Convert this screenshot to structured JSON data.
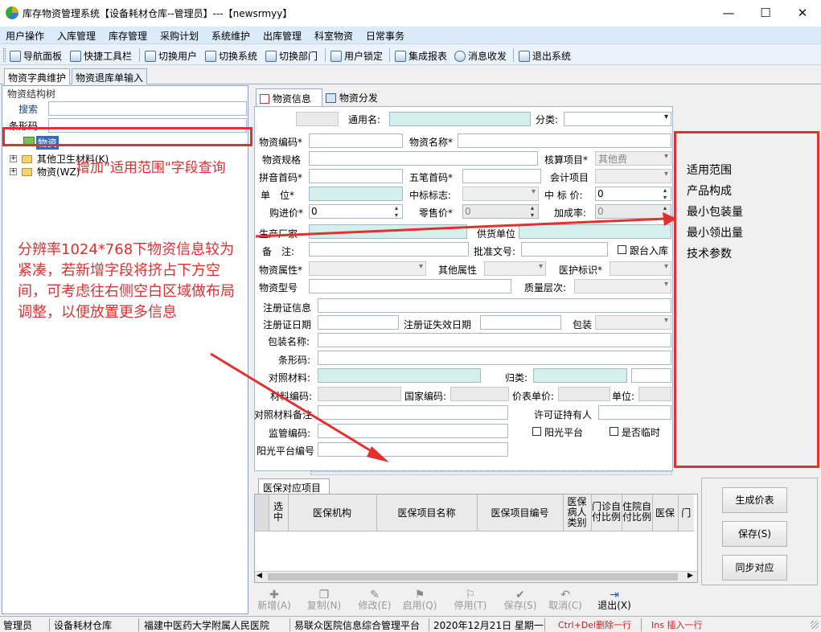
{
  "window": {
    "title": "库存物资管理系统【设备耗材仓库--管理员】---【newsrmyy】",
    "min": "—",
    "max": "☐",
    "close": "✕"
  },
  "menu": [
    "用户操作",
    "入库管理",
    "库存管理",
    "采购计划",
    "系统维护",
    "出库管理",
    "科室物资",
    "日常事务"
  ],
  "toolbar": [
    "导航面板",
    "快捷工具栏",
    "切换用户",
    "切换系统",
    "切换部门",
    "用户锁定",
    "集成报表",
    "消息收发",
    "退出系统"
  ],
  "tabs": [
    "物资字典维护",
    "物资退库单输入"
  ],
  "left": {
    "group": "物资结构树",
    "search": "搜索",
    "barcode": "条形码",
    "tree": [
      "物资",
      "其他卫生材料(K)",
      "物资(WZ)"
    ]
  },
  "subtabs": [
    "物资信息",
    "物资分发"
  ],
  "form": {
    "common_name": "通用名:",
    "category": "分类:",
    "code": "物资编码*",
    "name": "物资名称*",
    "spec": "物资规格",
    "acct_item": "核算项目*",
    "acct_item_val": "其他费",
    "pinyin": "拼音首码*",
    "wubi": "五笔首码*",
    "ledger_item": "会计项目",
    "unit": "单　位*",
    "bid_flag": "中标标志:",
    "bid_price": "中 标 价:",
    "bid_price_val": "0",
    "purchase_price": "购进价*",
    "purchase_price_val": "0",
    "retail_price": "零售价*",
    "retail_price_val": "0",
    "markup": "加成率:",
    "markup_val": "0",
    "maker": "生产厂家",
    "supplier": "供货单位",
    "remark": "备　注:",
    "approval": "批准文号:",
    "follow_in": "跟台入库",
    "attr": "物资属性*",
    "other_attr": "其他属性",
    "care_flag": "医护标识*",
    "model": "物资型号",
    "quality": "质量层次:",
    "reg_info": "注册证信息",
    "reg_date": "注册证日期",
    "reg_expire": "注册证失效日期",
    "package": "包装",
    "package_name": "包装名称:",
    "barcode": "条形码:",
    "compare_material": "对照材料:",
    "classify": "归类:",
    "material_code": "材料编码:",
    "national_code": "国家编码:",
    "price_unit_price": "价表单价:",
    "unit2": "单位:",
    "compare_remark": "对照材料备注",
    "license_holder": "许可证持有人",
    "supervise_code": "监管编码:",
    "sunshine": "阳光平台",
    "temporary": "是否临时",
    "sunshine_code": "阳光平台编号"
  },
  "annotations": {
    "a1": "增加\"适用范围\"字段查询",
    "a2": "分辨率1024*768下物资信息较为紧凑，若新增字段将挤占下方空间，可考虑往右侧空白区域做布局调整，以便放置更多信息",
    "new_fields": [
      "适用范围",
      "产品构成",
      "最小包装量",
      "最小领出量",
      "技术参数"
    ]
  },
  "medins": {
    "tab": "医保对应项目",
    "cols": [
      "选中",
      "医保机构",
      "医保项目名称",
      "医保项目编号",
      "医保病人类别",
      "门诊自付比例",
      "住院自付比例",
      "医保",
      "门"
    ]
  },
  "side_buttons": [
    "生成价表",
    "保存(S)",
    "同步对应"
  ],
  "bottom_buttons": [
    "新增(A)",
    "复制(N)",
    "修改(E)",
    "启用(Q)",
    "停用(T)",
    "保存(S)",
    "取消(C)",
    "退出(X)"
  ],
  "status": [
    "管理员",
    "设备耗材仓库",
    "福建中医药大学附属人民医院",
    "易联众医院信息综合管理平台",
    "2020年12月21日 星期一",
    "Ctrl+Del删除一行",
    "Ins 插入一行"
  ]
}
